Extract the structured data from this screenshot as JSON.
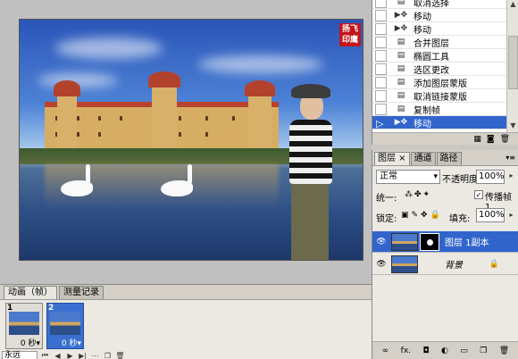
{
  "canvas": {
    "stamp_text": "扬飞\n印鹰"
  },
  "history": {
    "items": [
      {
        "label": "取消选择",
        "icon": "document-icon"
      },
      {
        "label": "移动",
        "icon": "move-icon"
      },
      {
        "label": "移动",
        "icon": "move-icon"
      },
      {
        "label": "合并图层",
        "icon": "document-icon"
      },
      {
        "label": "椭圆工具",
        "icon": "document-icon"
      },
      {
        "label": "选区更改",
        "icon": "document-icon"
      },
      {
        "label": "添加图层蒙版",
        "icon": "document-icon"
      },
      {
        "label": "取消链接蒙版",
        "icon": "document-icon"
      },
      {
        "label": "复制帧",
        "icon": "document-icon"
      },
      {
        "label": "移动",
        "icon": "move-icon",
        "selected": true
      }
    ]
  },
  "animation": {
    "tabs": [
      "动画（帧）",
      "测量记录"
    ],
    "frames": [
      {
        "number": "1",
        "delay": "0 秒▾"
      },
      {
        "number": "2",
        "delay": "0 秒▾",
        "selected": true
      }
    ],
    "loop": "永远"
  },
  "layers": {
    "tabs": [
      "图层",
      "通道",
      "路径"
    ],
    "blend_mode": "正常",
    "opacity_label": "不透明度:",
    "opacity": "100%",
    "unify_label": "统一:",
    "propagate_label": "传播帧 1",
    "lock_label": "锁定:",
    "fill_label": "填充:",
    "fill": "100%",
    "items": [
      {
        "name": "图层 1副本",
        "selected": true,
        "has_mask": true
      },
      {
        "name": "背景",
        "locked": true
      }
    ]
  },
  "colors": {
    "selection": "#3265cc",
    "panel": "#d4d0c8",
    "workspace": "#c0c0c0"
  }
}
